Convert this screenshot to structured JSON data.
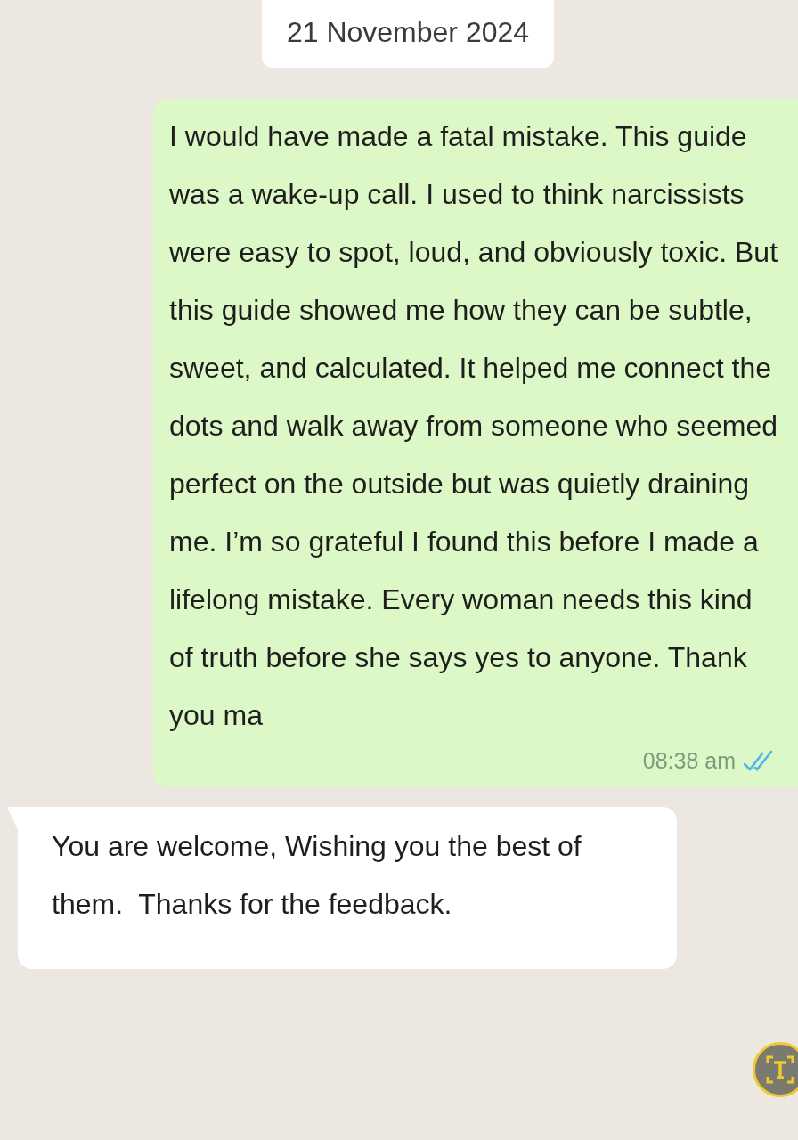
{
  "date_chip": "21 November 2024",
  "messages": [
    {
      "kind": "outgoing",
      "text": "I would have made a fatal mistake. This guide was a wake-up call. I used to think narcissists were easy to spot, loud, and obviously toxic. But this guide showed me how they can be subtle, sweet, and calculated. It helped me connect the dots and walk away from someone who seemed perfect on the outside but was quietly draining me. I’m so grateful I found this before I made a lifelong mistake. Every woman needs this kind of truth before she says yes to anyone. Thank you ma",
      "time": "08:38 am",
      "read": true
    },
    {
      "kind": "incoming",
      "text": "You are welcome, Wishing you the best of them.  Thanks for the feedback."
    }
  ]
}
